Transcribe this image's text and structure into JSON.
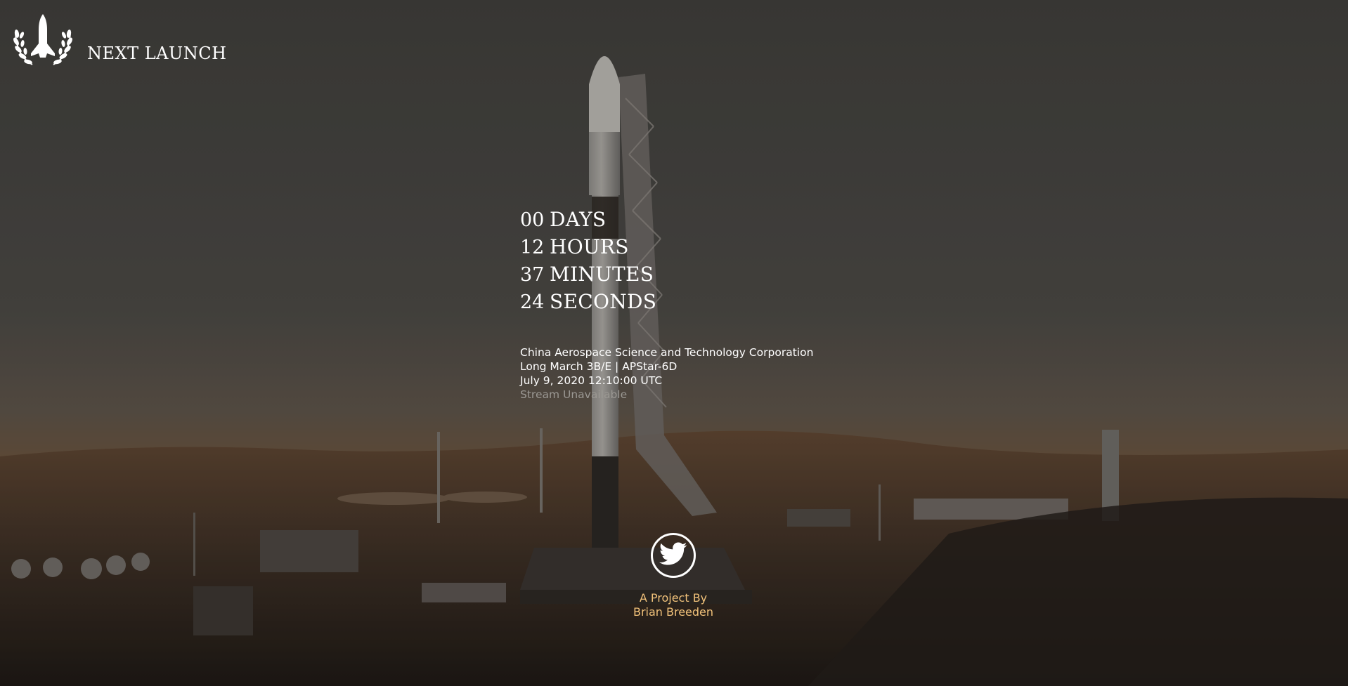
{
  "header": {
    "title": "NEXT LAUNCH",
    "logo_icon": "shuttle-laurel-icon"
  },
  "countdown": [
    {
      "value": "00",
      "unit": "DAYS"
    },
    {
      "value": "12",
      "unit": "HOURS"
    },
    {
      "value": "37",
      "unit": "MINUTES"
    },
    {
      "value": "24",
      "unit": "SECONDS"
    }
  ],
  "launch": {
    "provider": "China Aerospace Science and Technology Corporation",
    "mission": "Long March 3B/E | APStar-6D",
    "date": "July 9, 2020 12:10:00 UTC",
    "stream": "Stream Unavailable"
  },
  "footer": {
    "twitter_icon": "twitter-bird-icon",
    "credit_line1": "A Project By",
    "credit_line2": "Brian Breeden"
  },
  "colors": {
    "overlay": "#3b3a37",
    "credit": "#f2c27a",
    "muted": "#9b9893",
    "text": "#ffffff"
  }
}
